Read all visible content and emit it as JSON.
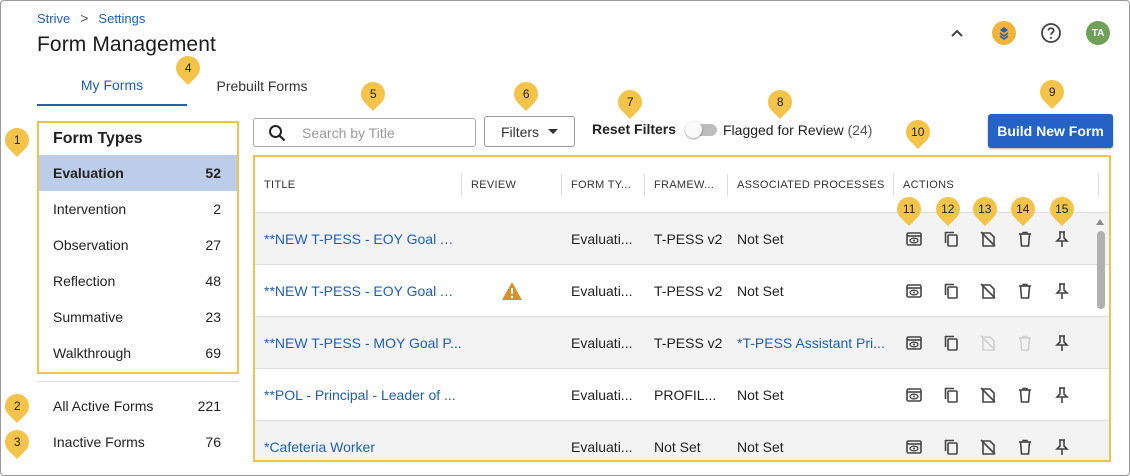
{
  "breadcrumb": {
    "root": "Strive",
    "separator": ">",
    "current": "Settings"
  },
  "page_title": "Form Management",
  "header_icons": {
    "collapse": "chevron-up-icon",
    "apps": "layers-icon",
    "help": "help-icon",
    "avatar": "TA"
  },
  "tabs": [
    {
      "label": "My Forms",
      "active": true
    },
    {
      "label": "Prebuilt Forms",
      "active": false
    }
  ],
  "form_types": {
    "title": "Form Types",
    "items": [
      {
        "label": "Evaluation",
        "count": "52",
        "selected": true
      },
      {
        "label": "Intervention",
        "count": "2"
      },
      {
        "label": "Observation",
        "count": "27"
      },
      {
        "label": "Reflection",
        "count": "48"
      },
      {
        "label": "Summative",
        "count": "23"
      },
      {
        "label": "Walkthrough",
        "count": "69"
      }
    ]
  },
  "status_filters": [
    {
      "label": "All Active Forms",
      "count": "221"
    },
    {
      "label": "Inactive Forms",
      "count": "76"
    }
  ],
  "toolbar": {
    "search_placeholder": "Search by Title",
    "filters_label": "Filters",
    "reset_label": "Reset Filters",
    "flag_label": "Flagged for Review",
    "flag_count": "(24)",
    "build_label": "Build New Form"
  },
  "table": {
    "headers": [
      "TITLE",
      "REVIEW",
      "FORM TY...",
      "FRAMEW...",
      "ASSOCIATED PROCESSES",
      "ACTIONS"
    ],
    "rows": [
      {
        "title": "**NEW T-PESS - EOY Goal At...",
        "review_warning": false,
        "form_type": "Evaluati...",
        "framework": "T-PESS v2",
        "processes": "Not Set",
        "processes_link": false,
        "archive_disabled": false
      },
      {
        "title": "**NEW T-PESS - EOY Goal At...",
        "review_warning": true,
        "form_type": "Evaluati...",
        "framework": "T-PESS v2",
        "processes": "Not Set",
        "processes_link": false,
        "archive_disabled": false
      },
      {
        "title": "**NEW T-PESS - MOY Goal P...",
        "review_warning": false,
        "form_type": "Evaluati...",
        "framework": "T-PESS v2",
        "processes": "*T-PESS Assistant Pri...",
        "processes_link": true,
        "archive_disabled": true
      },
      {
        "title": "**POL - Principal - Leader of ...",
        "review_warning": false,
        "form_type": "Evaluati...",
        "framework": "PROFIL...",
        "processes": "Not Set",
        "processes_link": false,
        "archive_disabled": false
      },
      {
        "title": "*Cafeteria Worker",
        "review_warning": false,
        "form_type": "Evaluati...",
        "framework": "Not Set",
        "processes": "Not Set",
        "processes_link": false,
        "archive_disabled": false
      }
    ],
    "action_icons": [
      "preview-icon",
      "copy-icon",
      "deactivate-icon",
      "trash-icon",
      "pin-icon"
    ]
  },
  "callouts": [
    "1",
    "2",
    "3",
    "4",
    "5",
    "6",
    "7",
    "8",
    "9",
    "10",
    "11",
    "12",
    "13",
    "14",
    "15"
  ],
  "colors": {
    "accent": "#1f5fb4",
    "button": "#2463c5",
    "selected_row": "#bccde9",
    "highlight_border": "#f0c34e",
    "callout": "#f3c34a",
    "warning": "#d9902a"
  }
}
